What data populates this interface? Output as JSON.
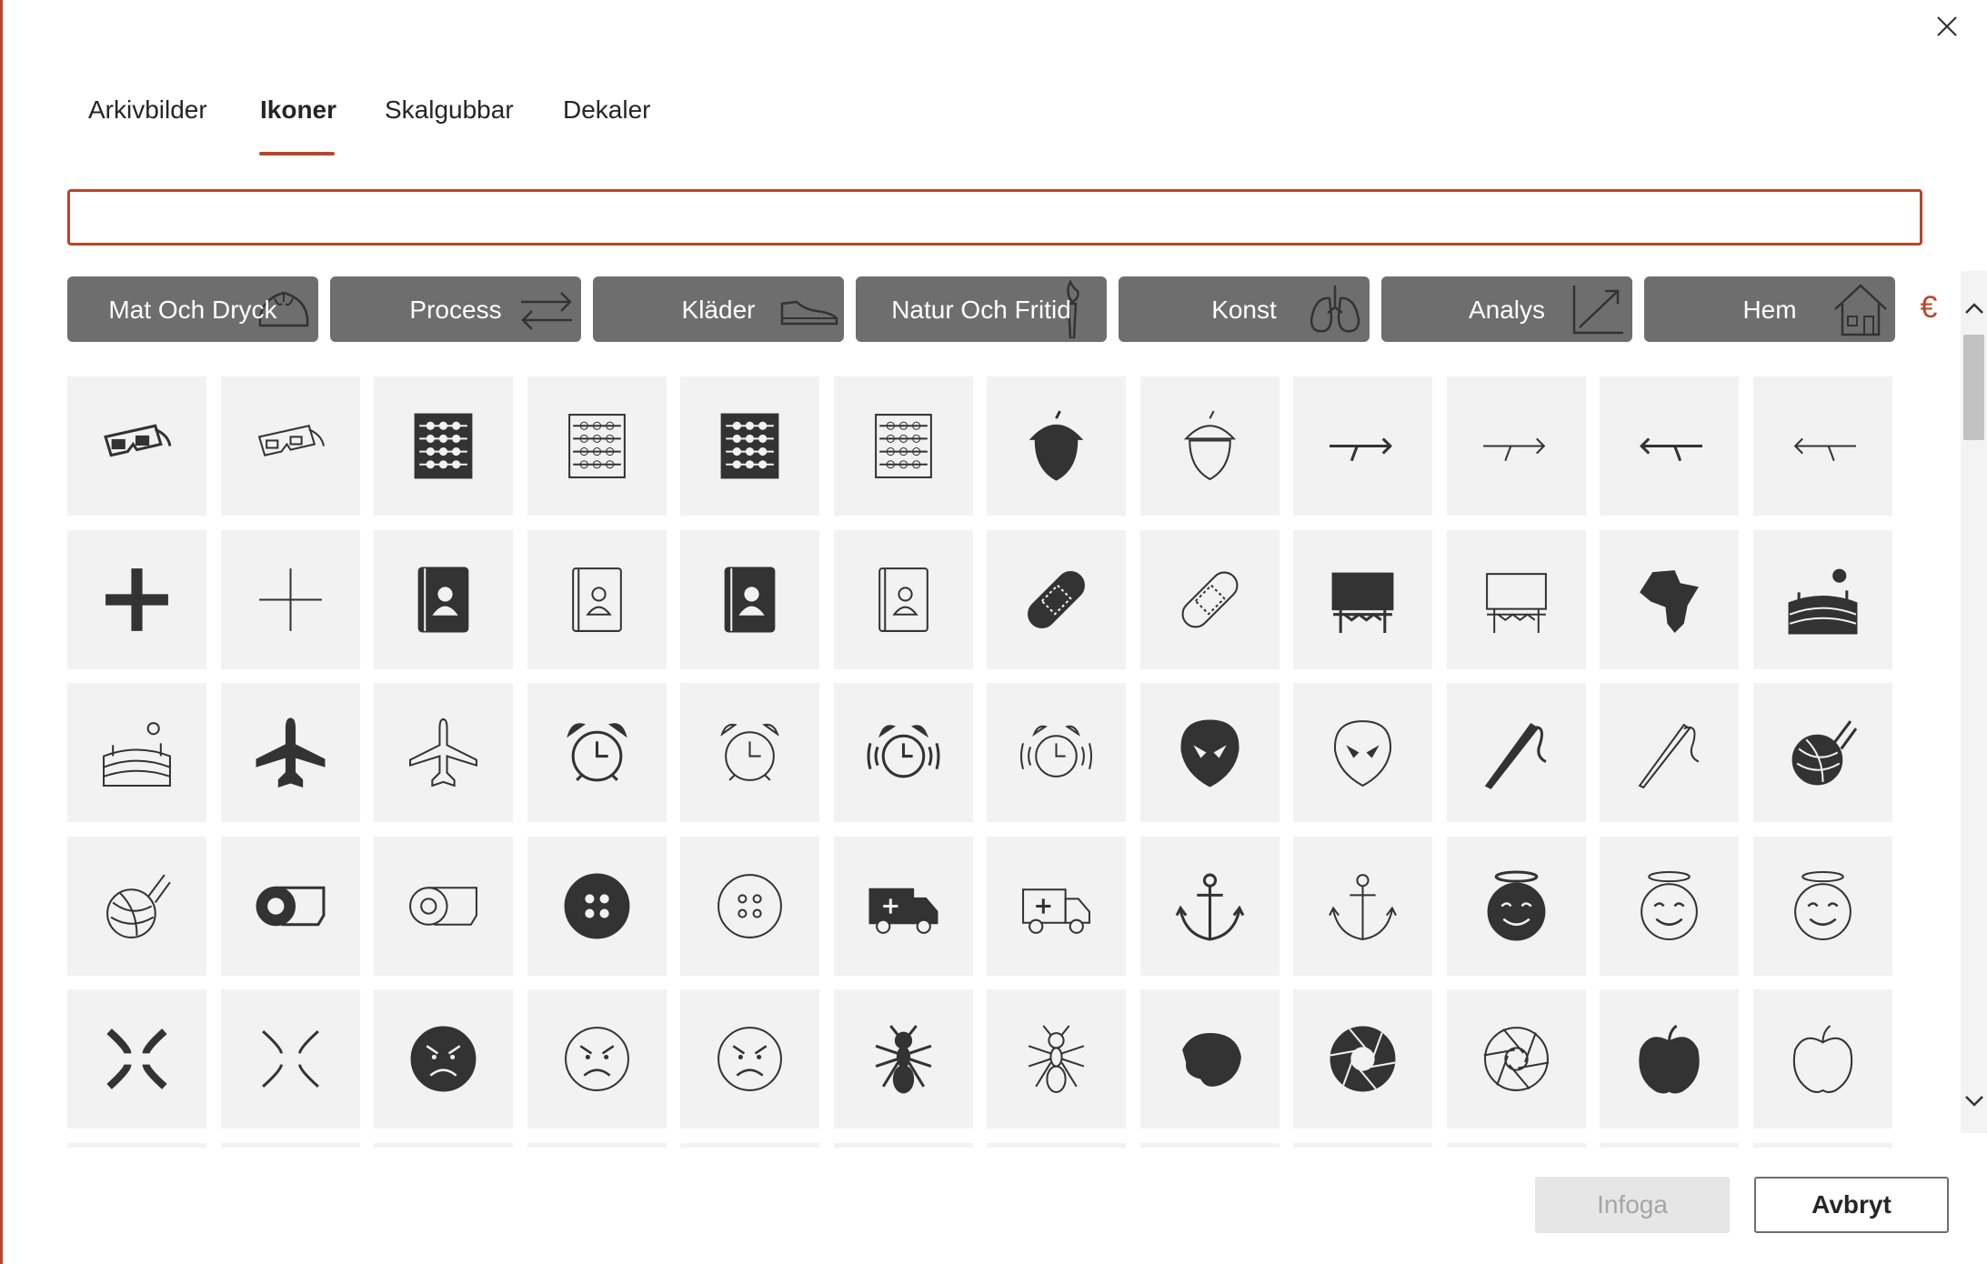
{
  "dialog": {
    "close_icon": "close-icon",
    "accent_color": "#b7472a"
  },
  "tabs": [
    {
      "label": "Arkivbilder",
      "active": false
    },
    {
      "label": "Ikoner",
      "active": true
    },
    {
      "label": "Skalgubbar",
      "active": false
    },
    {
      "label": "Dekaler",
      "active": false
    }
  ],
  "search": {
    "value": "",
    "placeholder": ""
  },
  "categories": [
    {
      "label": "Mat Och Dryck",
      "icon": "dumpling-icon"
    },
    {
      "label": "Process",
      "icon": "arrows-exchange-icon"
    },
    {
      "label": "Kläder",
      "icon": "shoe-icon"
    },
    {
      "label": "Natur Och Fritid",
      "icon": "torch-icon"
    },
    {
      "label": "Konst",
      "icon": "lungs-icon"
    },
    {
      "label": "Analys",
      "icon": "trend-chart-icon"
    },
    {
      "label": "Hem",
      "icon": "house-icon"
    }
  ],
  "icons": [
    [
      "3d-glasses-filled-icon",
      "3d-glasses-outline-icon",
      "abacus-filled-icon",
      "abacus-outline-icon",
      "abacus-filled-icon",
      "abacus-outline-icon",
      "acorn-filled-icon",
      "acorn-outline-icon",
      "arrow-right-turn-filled-icon",
      "arrow-right-turn-outline-icon",
      "arrow-left-turn-filled-icon",
      "arrow-left-turn-outline-icon"
    ],
    [
      "plus-filled-icon",
      "plus-outline-icon",
      "address-book-filled-icon",
      "address-book-outline-icon",
      "address-book-filled-icon",
      "address-book-outline-icon",
      "bandage-filled-icon",
      "bandage-outline-icon",
      "billboard-filled-icon",
      "billboard-outline-icon",
      "africa-map-icon",
      "farm-landscape-filled-icon"
    ],
    [
      "farm-landscape-outline-icon",
      "airplane-filled-icon",
      "airplane-outline-icon",
      "alarm-clock-filled-icon",
      "alarm-clock-outline-icon",
      "alarm-ringing-filled-icon",
      "alarm-ringing-outline-icon",
      "alien-face-filled-icon",
      "alien-face-outline-icon",
      "needle-thread-filled-icon",
      "needle-thread-outline-icon",
      "yarn-ball-filled-icon"
    ],
    [
      "yarn-ball-outline-icon",
      "measuring-tape-filled-icon",
      "measuring-tape-outline-icon",
      "button-filled-icon",
      "button-outline-icon",
      "ambulance-filled-icon",
      "ambulance-outline-icon",
      "anchor-filled-icon",
      "anchor-outline-icon",
      "angel-face-filled-icon",
      "angel-face-outline-icon",
      "angel-face-outline-icon"
    ],
    [
      "anger-symbol-filled-icon",
      "anger-symbol-outline-icon",
      "angry-face-filled-icon",
      "angry-face-outline-icon",
      "angry-face-outline-icon",
      "ant-filled-icon",
      "ant-outline-icon",
      "antarctica-map-icon",
      "aperture-filled-icon",
      "aperture-outline-icon",
      "apple-filled-icon",
      "apple-outline-icon"
    ]
  ],
  "scrollbar": {
    "position": 0.0
  },
  "footer": {
    "insert_label": "Infoga",
    "cancel_label": "Avbryt",
    "insert_enabled": false
  }
}
